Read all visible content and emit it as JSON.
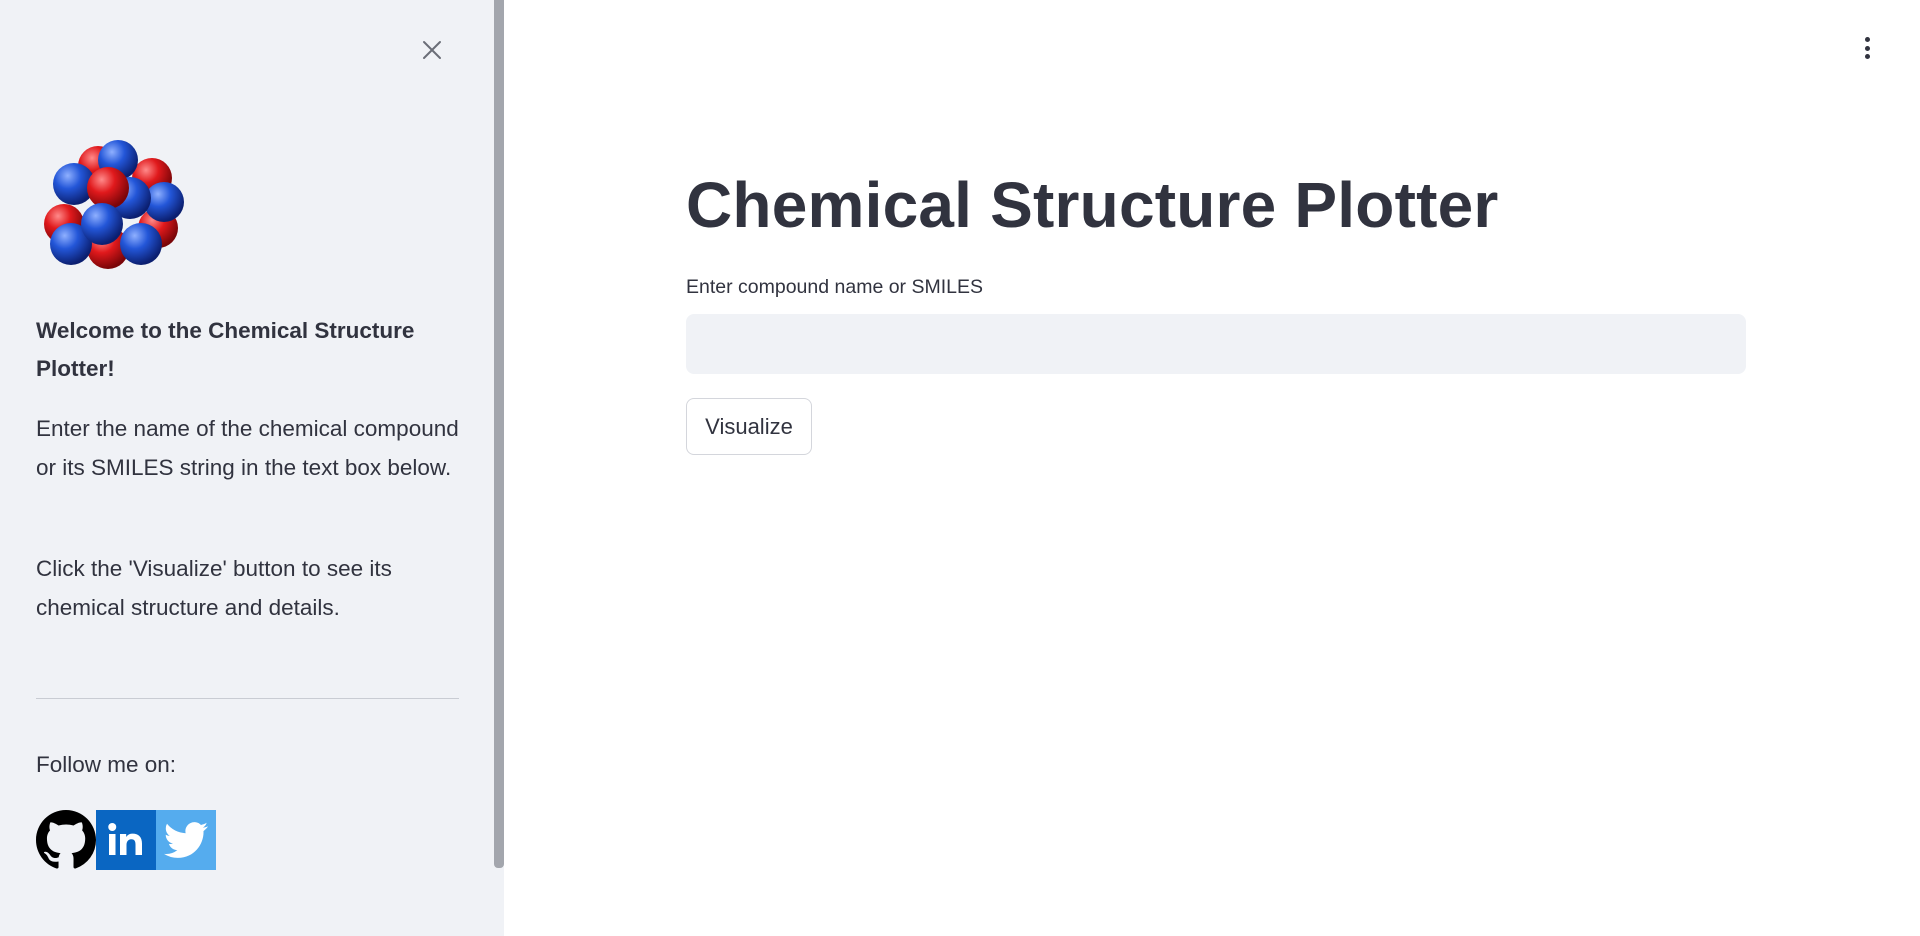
{
  "sidebar": {
    "welcome_text": "Welcome to the Chemical Structure Plotter!",
    "para1": "Enter the name of the chemical compound or its SMILES string in the text box below.",
    "para2": "Click the 'Visualize' button to see its chemical structure and details.",
    "follow_label": "Follow me on:",
    "socials": [
      {
        "icon": "github-icon",
        "color": "#000000"
      },
      {
        "icon": "linkedin-icon",
        "color": "#0a66c2"
      },
      {
        "icon": "twitter-icon",
        "color": "#55acee"
      }
    ]
  },
  "main": {
    "title": "Chemical Structure Plotter",
    "input_label": "Enter compound name or SMILES",
    "input_value": "",
    "input_placeholder": "",
    "button_label": "Visualize"
  },
  "colors": {
    "sidebar_bg": "#f0f2f6",
    "text": "#31333f",
    "atom_red": "#e0191c",
    "atom_blue": "#1f4fd1"
  }
}
